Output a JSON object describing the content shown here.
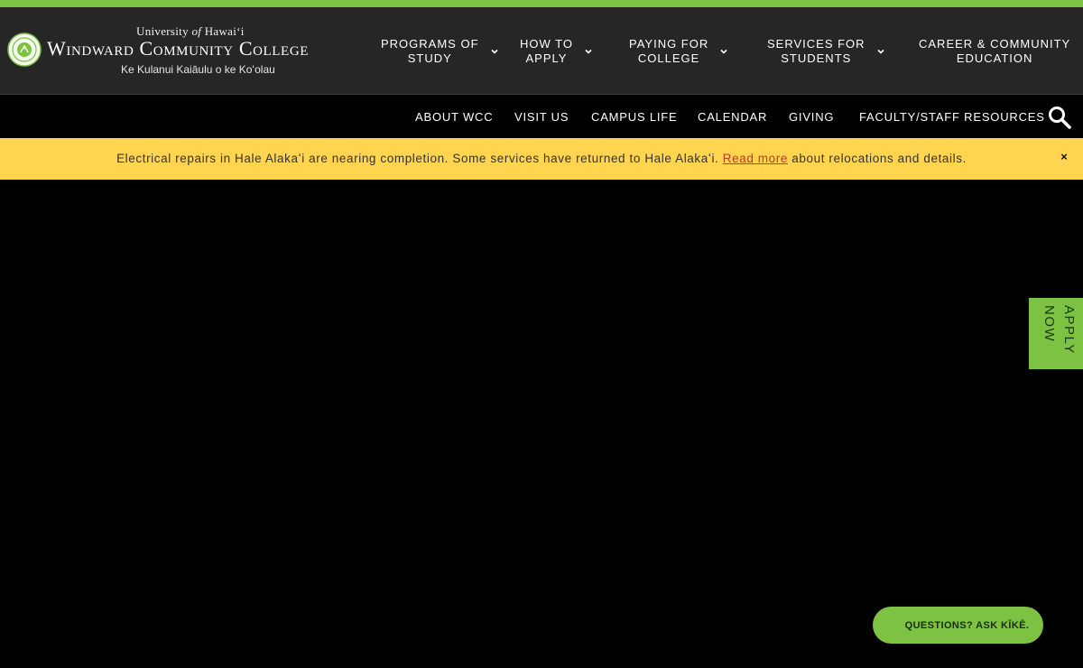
{
  "brand": {
    "university_prefix": "University",
    "university_of": "of",
    "university_name": "Hawai‘i",
    "college_name": "Windward Community College",
    "motto": "Ke Kulanui Kaiāulu o ke Koʻolau"
  },
  "main_nav": [
    {
      "label": "PROGRAMS OF\nSTUDY",
      "has_dropdown": true
    },
    {
      "label": "HOW TO\nAPPLY",
      "has_dropdown": true
    },
    {
      "label": "PAYING FOR\nCOLLEGE",
      "has_dropdown": true
    },
    {
      "label": "SERVICES FOR\nSTUDENTS",
      "has_dropdown": true
    },
    {
      "label": "CAREER & COMMUNITY\nEDUCATION",
      "has_dropdown": false
    }
  ],
  "sub_nav": {
    "links": [
      "ABOUT WCC",
      "VISIT US",
      "CAMPUS LIFE",
      "CALENDAR",
      "GIVING",
      "FACULTY/STAFF RESOURCES"
    ],
    "search_icon": "search-icon"
  },
  "alert": {
    "text_before": "Electrical repairs in Hale Alakaʻi are nearing completion. Some services have returned to Hale Alakaʻi. ",
    "link_text": "Read more",
    "text_after": " about relocations and details.",
    "close_label": "×"
  },
  "apply_now": {
    "label": "APPLY\nNOW"
  },
  "chat": {
    "label": "QUESTIONS? ASK KĪKĒ."
  },
  "colors": {
    "accent_green": "#7dc242",
    "header_bg": "#262626",
    "alert_bg": "#ffd44f",
    "link_red": "#c0392b"
  }
}
